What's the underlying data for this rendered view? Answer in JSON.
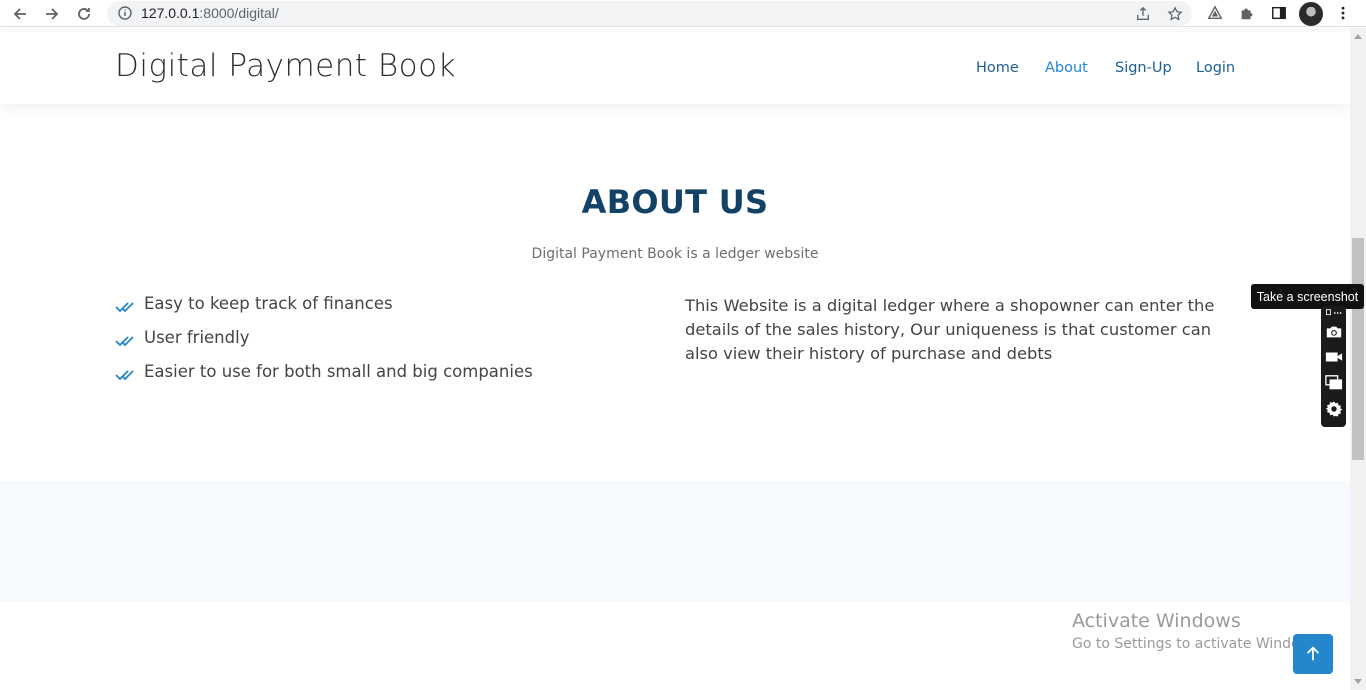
{
  "browser": {
    "url_host": "127.0.0.1",
    "url_path": ":8000/digital/"
  },
  "header": {
    "brand": "Digital Payment Book",
    "nav": [
      {
        "label": "Home",
        "active": false
      },
      {
        "label": "About",
        "active": true
      },
      {
        "label": "Sign-Up",
        "active": false
      },
      {
        "label": "Login",
        "active": false
      }
    ]
  },
  "about": {
    "title": "ABOUT US",
    "subtitle": "Digital Payment Book is a ledger website",
    "features": [
      "Easy to keep track of finances",
      "User friendly",
      "Easier to use for both small and big companies"
    ],
    "description": "This Website is a digital ledger where a shopowner can enter the details of the sales history, Our uniqueness is that customer can also view their history of purchase and debts"
  },
  "extension": {
    "tooltip": "Take a screenshot"
  },
  "watermark": {
    "line1": "Activate Windows",
    "line2": "Go to Settings to activate Windows."
  },
  "colors": {
    "accent": "#2487ce",
    "heading": "#124265",
    "nav_link": "#1c5f94"
  }
}
